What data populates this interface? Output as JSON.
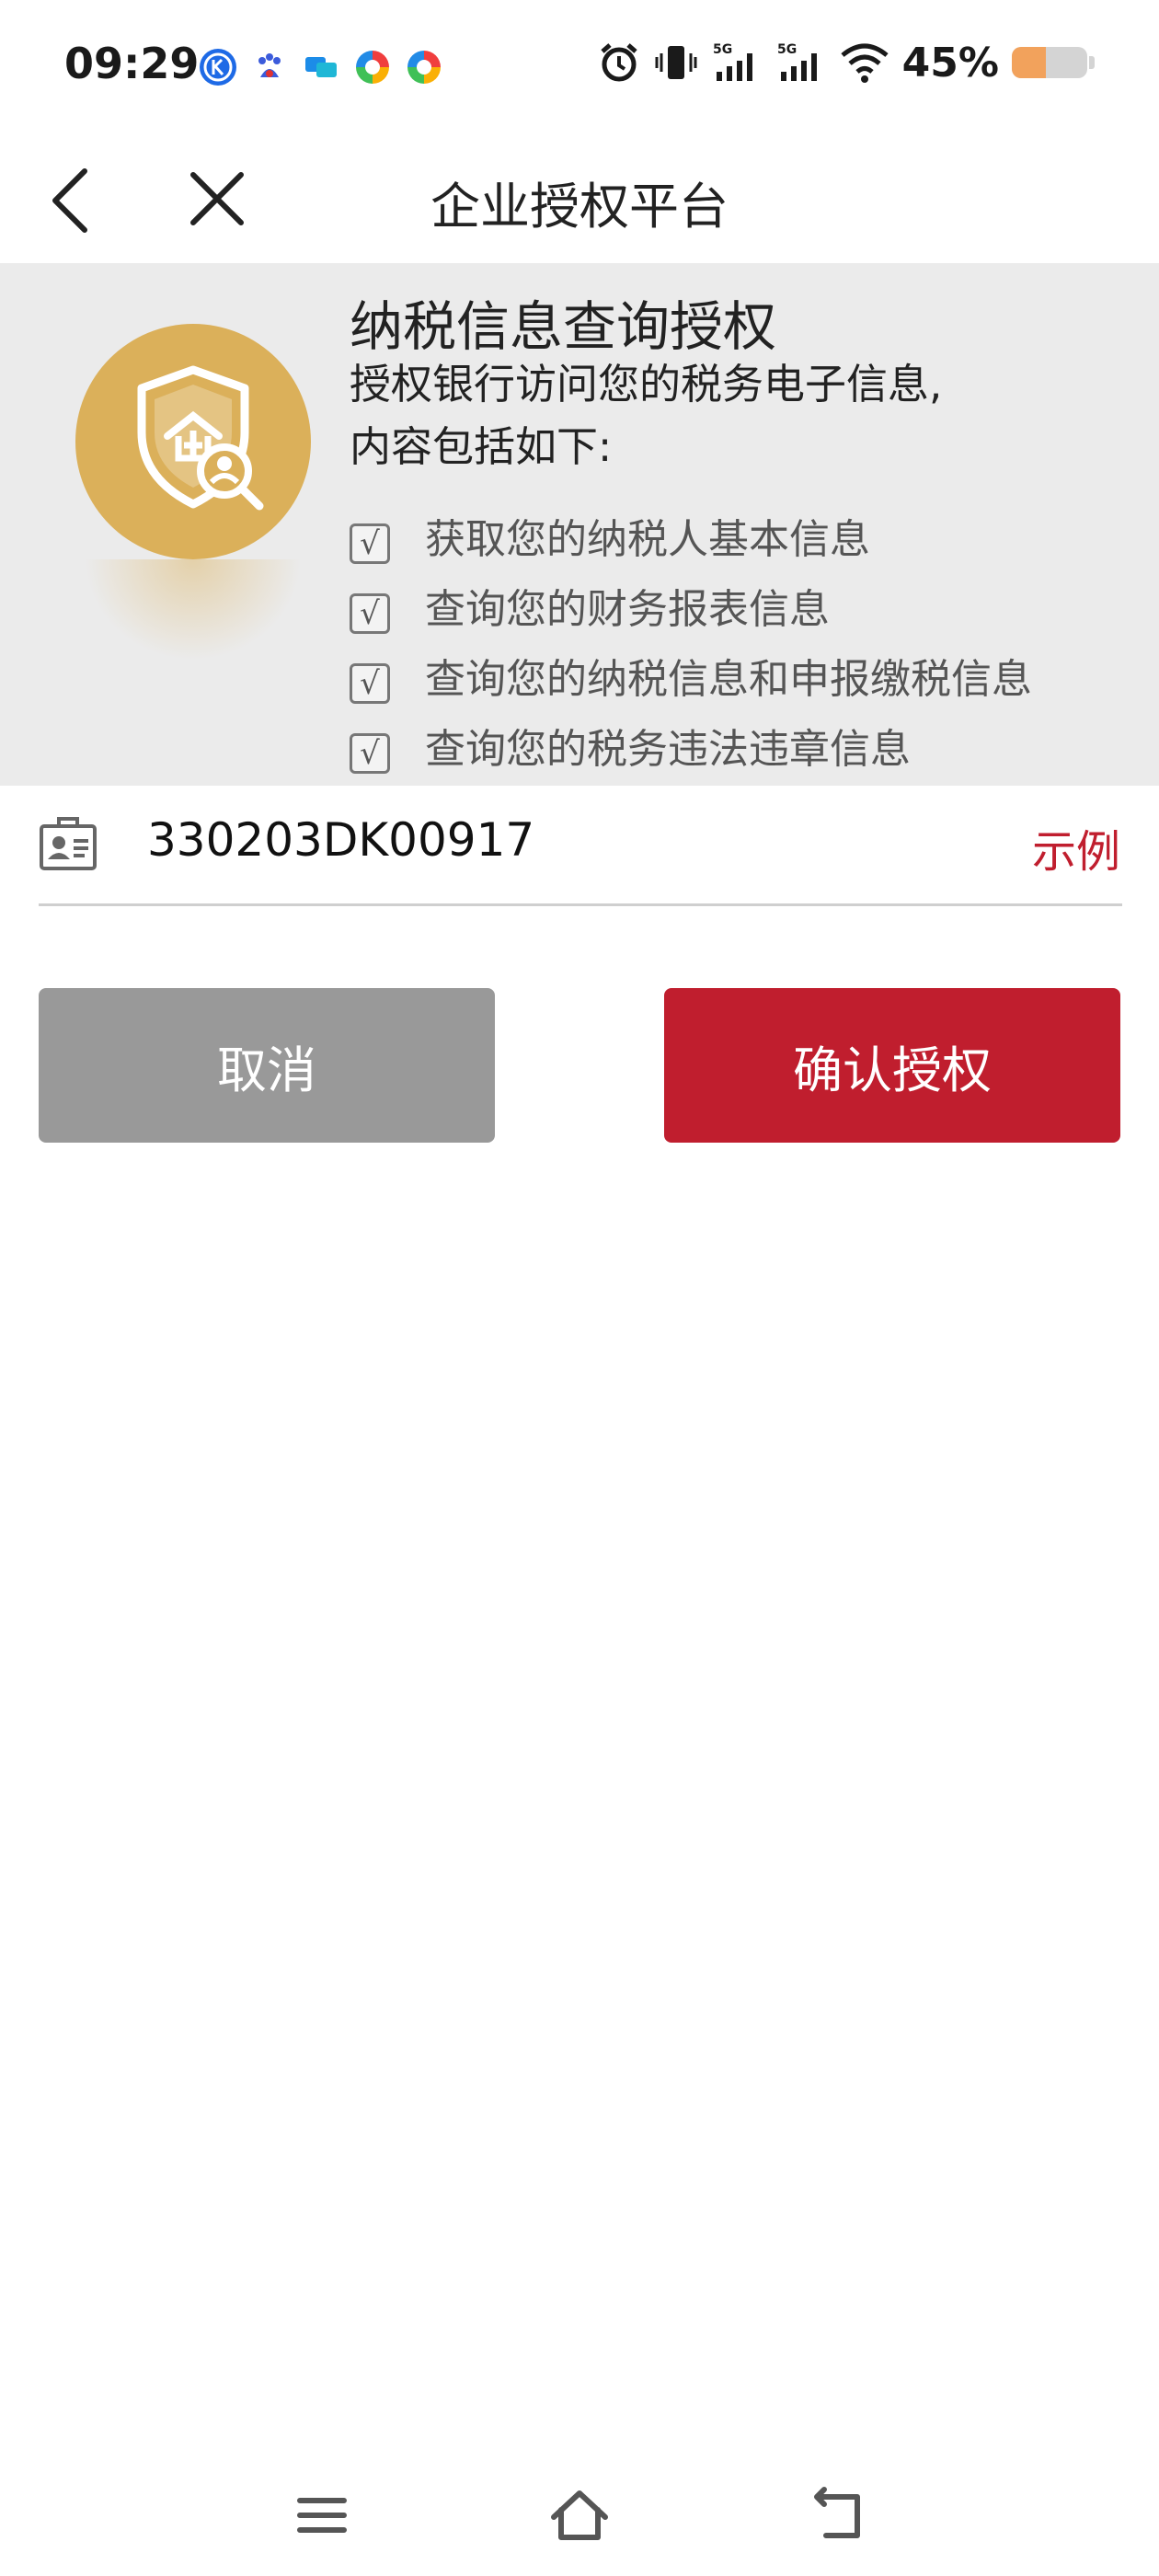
{
  "status_bar": {
    "time": "09:29",
    "battery_text": "45%",
    "battery_level": 0.45,
    "icons": [
      "k-app-icon",
      "baidu-icon",
      "chat-app-icon",
      "colorful-app-icon",
      "colorful-app-icon-2",
      "alarm-icon",
      "vibrate-icon",
      "signal-5g-icon",
      "signal-5g-icon-2",
      "wifi-icon",
      "battery-icon"
    ]
  },
  "title_bar": {
    "title": "企业授权平台",
    "back_icon": "chevron-left-icon",
    "close_icon": "close-icon"
  },
  "info": {
    "badge_icon": "shield-enterprise-search-icon",
    "title": "纳税信息查询授权",
    "desc_line1": "授权银行访问您的税务电子信息,",
    "desc_line2": "内容包括如下:",
    "check_mark": "√",
    "items": [
      {
        "label": "获取您的纳税人基本信息"
      },
      {
        "label": "查询您的财务报表信息"
      },
      {
        "label": "查询您的纳税信息和申报缴税信息"
      },
      {
        "label": "查询您的税务违法违章信息"
      }
    ]
  },
  "taxpayer": {
    "id_icon": "id-card-icon",
    "value": "330203DK00917",
    "example_label": "示例"
  },
  "actions": {
    "cancel_label": "取消",
    "confirm_label": "确认授权"
  },
  "nav_bar": {
    "menu_icon": "menu-icon",
    "home_icon": "home-icon",
    "back_icon": "back-icon"
  },
  "colors": {
    "accent_red": "#c01e2e",
    "cancel_gray": "#999999",
    "badge_gold": "#dbb05a",
    "banner_bg": "#ebebeb"
  }
}
